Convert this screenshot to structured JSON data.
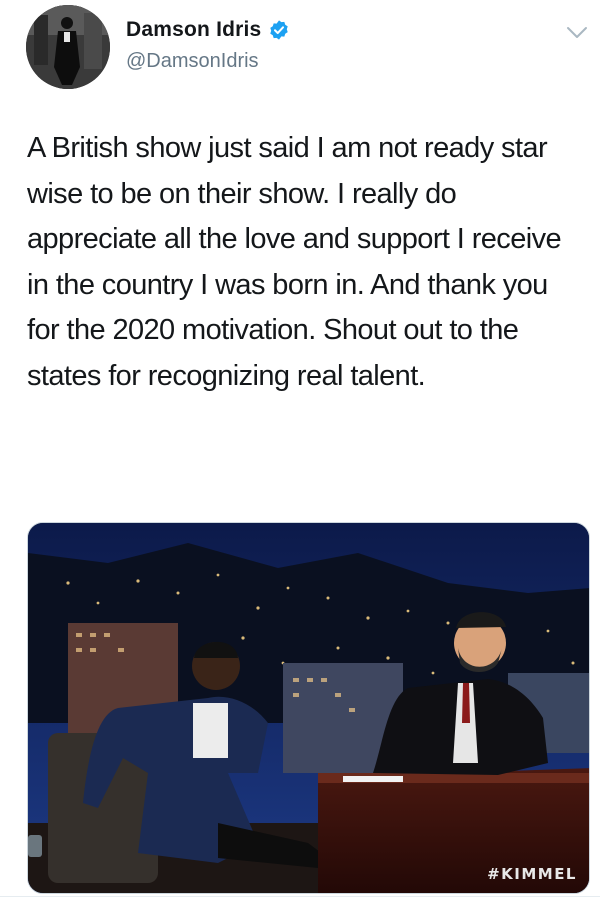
{
  "user": {
    "display_name": "Damson Idris",
    "handle": "@DamsonIdris",
    "verified_icon": "verified-badge-icon",
    "menu_icon": "chevron-down-icon"
  },
  "tweet": {
    "text": "A British show just said I am not ready star wise to be on their show. I really do appreciate all the love and support I receive in the country I was born in. And thank you for the 2020 motivation. Shout out to the states for recognizing real talent."
  },
  "media": {
    "watermark": "#KIMMEL"
  },
  "colors": {
    "verified": "#1da1f2",
    "handle": "#657786",
    "text": "#14171a"
  }
}
